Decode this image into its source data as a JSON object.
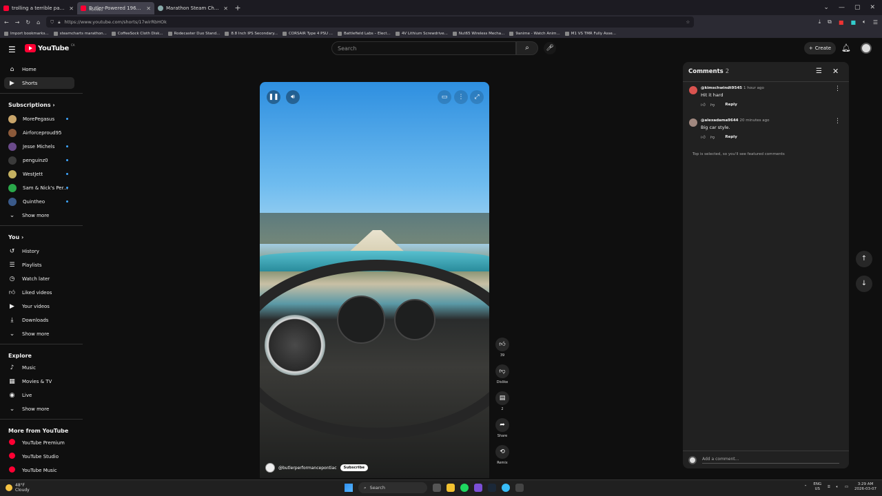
{
  "browser": {
    "tabs": [
      {
        "title": "trolling a terrible pay to win gt",
        "sub": "",
        "icon": "youtube-icon"
      },
      {
        "title": "Butler-Powered 1969 Grand Pr",
        "sub": "PLAYING",
        "icon": "youtube-icon",
        "active": true
      },
      {
        "title": "Marathon Steam Charts - Steam",
        "sub": "",
        "icon": "steam-icon"
      }
    ],
    "url": "https://www.youtube.com/shorts/17wirRbHOk",
    "bookmarks": [
      "Import bookmarks...",
      "steamcharts marathon...",
      "CoffeeSock Cloth Disk...",
      "Rodecaster Duo Stand...",
      "8.8 Inch IPS Secondary...",
      "CORSAIR Type 4 PSU ...",
      "Battlefield Labs – Elect...",
      "4V Lithium Screwdrive...",
      "Nut65 Wireless Mecha...",
      "9anime - Watch Anim...",
      "M1 VS TMR Fully Asse..."
    ]
  },
  "masthead": {
    "logo_text": "YouTube",
    "logo_region": "CA",
    "search_placeholder": "Search",
    "create_label": "Create"
  },
  "sidebar": {
    "main": [
      {
        "label": "Home",
        "icon": "home-icon"
      },
      {
        "label": "Shorts",
        "icon": "shorts-icon",
        "active": true
      }
    ],
    "subscriptions_header": "Subscriptions",
    "subscriptions": [
      {
        "label": "MorePegasus",
        "color": "#c9a56a",
        "new": true
      },
      {
        "label": "Airforceproud95",
        "color": "#8c5a3a",
        "new": false
      },
      {
        "label": "Jesse Michels",
        "color": "#6a4a8a",
        "new": true
      },
      {
        "label": "penguinz0",
        "color": "#3a3a3a",
        "new": true
      },
      {
        "label": "WestJett",
        "color": "#c4b060",
        "new": true
      },
      {
        "label": "Sam & Nick's Per...",
        "color": "#2aa84a",
        "new": true
      },
      {
        "label": "Quintheo",
        "color": "#3a5a8a",
        "new": true
      }
    ],
    "subs_show_more": "Show more",
    "you_header": "You",
    "you": [
      {
        "label": "History",
        "icon": "history-icon"
      },
      {
        "label": "Playlists",
        "icon": "playlists-icon"
      },
      {
        "label": "Watch later",
        "icon": "clock-icon"
      },
      {
        "label": "Liked videos",
        "icon": "thumbs-up-icon"
      },
      {
        "label": "Your videos",
        "icon": "video-icon"
      },
      {
        "label": "Downloads",
        "icon": "download-icon"
      }
    ],
    "you_show_more": "Show more",
    "explore_header": "Explore",
    "explore": [
      {
        "label": "Music",
        "icon": "music-icon"
      },
      {
        "label": "Movies & TV",
        "icon": "film-icon"
      },
      {
        "label": "Live",
        "icon": "live-icon"
      }
    ],
    "explore_show_more": "Show more",
    "more_header": "More from YouTube",
    "more": [
      {
        "label": "YouTube Premium"
      },
      {
        "label": "YouTube Studio"
      },
      {
        "label": "YouTube Music"
      }
    ]
  },
  "video": {
    "channel": "@butlerperformancepontiac",
    "subscribe_label": "Subscribe"
  },
  "actions": {
    "like_count": "39",
    "dislike_label": "Dislike",
    "comment_count": "2",
    "share_label": "Share",
    "remix_label": "Remix"
  },
  "comments": {
    "title": "Comments",
    "count": "2",
    "items": [
      {
        "user": "@kimschwindt9545",
        "time": "1 hour ago",
        "text": "Hit it hard",
        "reply": "Reply",
        "avatar_color": "#d9534f"
      },
      {
        "user": "@alexadama9644",
        "time": "20 minutes ago",
        "text": "Big car style.",
        "reply": "Reply",
        "avatar_color": "#a1887f"
      }
    ],
    "note": "Top is selected, so you'll see featured comments",
    "add_placeholder": "Add a comment..."
  },
  "taskbar": {
    "temp": "48°F",
    "weather": "Cloudy",
    "search_label": "Search",
    "lang": "ENG",
    "region": "US",
    "time": "3:29 AM",
    "date": "2026-03-07"
  }
}
